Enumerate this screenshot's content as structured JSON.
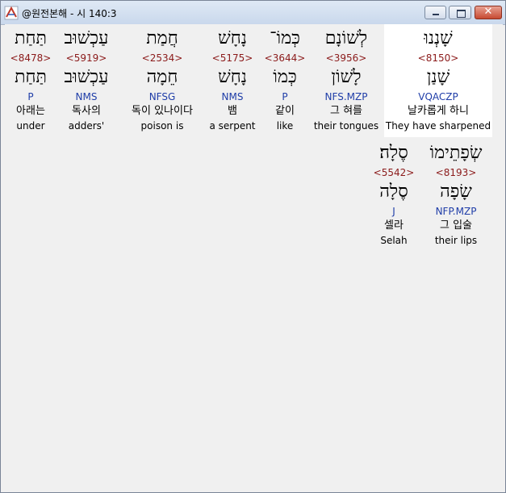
{
  "window": {
    "title": "@원전본해 - 시 140:3"
  },
  "row1": [
    {
      "heb": "שָׁנְנוּ",
      "strong": "<8150>",
      "lemma": "שָׁנַן",
      "morph": "VQACZP",
      "kor": "날카롭게 하니",
      "eng": "They have sharpened"
    },
    {
      "heb": "לְשׁוֹנָם",
      "strong": "<3956>",
      "lemma": "לָשׁוֹן",
      "morph": "NFS.MZP",
      "kor": "그 혀를",
      "eng": "their tongues"
    },
    {
      "heb": "כְּמוֹ־",
      "strong": "<3644>",
      "lemma": "כְּמוֹ",
      "morph": "P",
      "kor": "같이",
      "eng": "like"
    },
    {
      "heb": "נָחָשׁ",
      "strong": "<5175>",
      "lemma": "נָחָשׁ",
      "morph": "NMS",
      "kor": "뱀",
      "eng": "a serpent"
    },
    {
      "heb": "חֲמַת",
      "strong": "<2534>",
      "lemma": "חֵמָה",
      "morph": "NFSG",
      "kor": "독이 있나이다",
      "eng": "poison is"
    },
    {
      "heb": "עַכְשׁוּב",
      "strong": "<5919>",
      "lemma": "עַכְשׁוּב",
      "morph": "NMS",
      "kor": "독사의",
      "eng": "adders'"
    },
    {
      "heb": "תַּחַת",
      "strong": "<8478>",
      "lemma": "תַּחַת",
      "morph": "P",
      "kor": "아래는",
      "eng": "under"
    }
  ],
  "row2": [
    {
      "heb": "שְׂפָתֵימוֹ",
      "strong": "<8193>",
      "lemma": "שָׂפָה",
      "morph": "NFP.MZP",
      "kor": "그 입술",
      "eng": "their lips"
    },
    {
      "heb": "סֶלָה׃",
      "strong": "<5542>",
      "lemma": "סֶלָה",
      "morph": "J",
      "kor": "셀라",
      "eng": "Selah"
    }
  ]
}
